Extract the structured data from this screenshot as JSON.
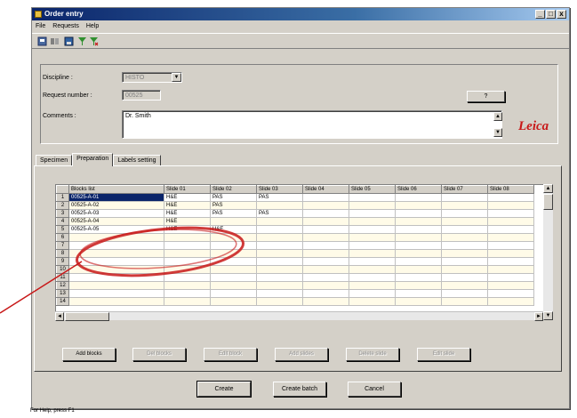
{
  "window": {
    "title": "Order entry",
    "controls": [
      "_",
      "□",
      "x"
    ]
  },
  "menu": [
    "File",
    "Requests",
    "Help"
  ],
  "form": {
    "discipline_label": "Discipline :",
    "discipline_value": "HISTO",
    "request_label": "Request number :",
    "request_value": "00525",
    "request_button": "?",
    "comments_label": "Comments :",
    "comments_value": "Dr. Smith",
    "logo_text": "Leica"
  },
  "tabs": [
    {
      "label": "Specimen",
      "active": false
    },
    {
      "label": "Preparation",
      "active": true
    },
    {
      "label": "Labels setting",
      "active": false
    }
  ],
  "grid": {
    "columns": [
      "Blocks list",
      "Slide 01",
      "Slide 02",
      "Slide 03",
      "Slide 04",
      "Slide 05",
      "Slide 06",
      "Slide 07",
      "Slide 08"
    ],
    "rows": [
      {
        "num": "1",
        "cells": [
          "00525-A-01",
          "H&E",
          "PAS",
          "PAS",
          "",
          "",
          "",
          "",
          ""
        ]
      },
      {
        "num": "2",
        "cells": [
          "00525-A-02",
          "H&E",
          "PAS",
          "",
          "",
          "",
          "",
          "",
          ""
        ]
      },
      {
        "num": "3",
        "cells": [
          "00525-A-03",
          "H&E",
          "PAS",
          "PAS",
          "",
          "",
          "",
          "",
          ""
        ]
      },
      {
        "num": "4",
        "cells": [
          "00525-A-04",
          "H&E",
          "",
          "",
          "",
          "",
          "",
          "",
          ""
        ]
      },
      {
        "num": "5",
        "cells": [
          "00525-A-05",
          "H&E",
          "H&E",
          "",
          "",
          "",
          "",
          "",
          ""
        ]
      },
      {
        "num": "6",
        "cells": [
          "",
          "",
          "",
          "",
          "",
          "",
          "",
          "",
          ""
        ]
      },
      {
        "num": "7",
        "cells": [
          "",
          "",
          "",
          "",
          "",
          "",
          "",
          "",
          ""
        ]
      },
      {
        "num": "8",
        "cells": [
          "",
          "",
          "",
          "",
          "",
          "",
          "",
          "",
          ""
        ]
      },
      {
        "num": "9",
        "cells": [
          "",
          "",
          "",
          "",
          "",
          "",
          "",
          "",
          ""
        ]
      },
      {
        "num": "10",
        "cells": [
          "",
          "",
          "",
          "",
          "",
          "",
          "",
          "",
          ""
        ]
      },
      {
        "num": "11",
        "cells": [
          "",
          "",
          "",
          "",
          "",
          "",
          "",
          "",
          ""
        ]
      },
      {
        "num": "12",
        "cells": [
          "",
          "",
          "",
          "",
          "",
          "",
          "",
          "",
          ""
        ]
      },
      {
        "num": "13",
        "cells": [
          "",
          "",
          "",
          "",
          "",
          "",
          "",
          "",
          ""
        ]
      },
      {
        "num": "14",
        "cells": [
          "",
          "",
          "",
          "",
          "",
          "",
          "",
          "",
          ""
        ]
      }
    ]
  },
  "grid_buttons": [
    {
      "label": "Add blocks",
      "enabled": true
    },
    {
      "label": "Del blocks",
      "enabled": false
    },
    {
      "label": "Edit block",
      "enabled": false
    },
    {
      "label": "Add slides",
      "enabled": false
    },
    {
      "label": "Delete slide",
      "enabled": false
    },
    {
      "label": "Edit slide",
      "enabled": false
    }
  ],
  "actions": {
    "create": "Create",
    "create_batch": "Create batch",
    "cancel": "Cancel"
  },
  "status": "For Help, press F1",
  "colors": {
    "selection": "#0a246a",
    "annotation": "#c81818",
    "logo": "#c81818"
  }
}
